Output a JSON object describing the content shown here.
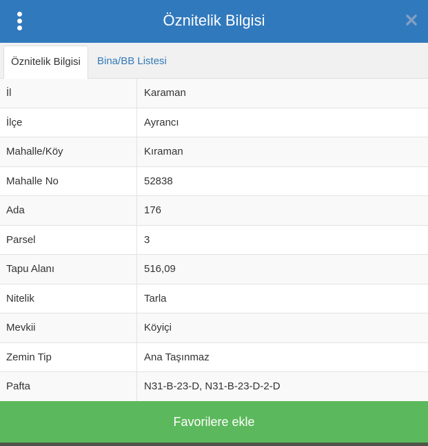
{
  "header": {
    "title": "Öznitelik Bilgisi"
  },
  "tabs": [
    {
      "label": "Öznitelik Bilgisi",
      "active": true
    },
    {
      "label": "Bina/BB Listesi",
      "active": false
    }
  ],
  "attributes": [
    {
      "key": "İl",
      "value": "Karaman"
    },
    {
      "key": "İlçe",
      "value": "Ayrancı"
    },
    {
      "key": "Mahalle/Köy",
      "value": "Kıraman"
    },
    {
      "key": "Mahalle No",
      "value": "52838"
    },
    {
      "key": "Ada",
      "value": "176"
    },
    {
      "key": "Parsel",
      "value": "3"
    },
    {
      "key": "Tapu Alanı",
      "value": "516,09"
    },
    {
      "key": "Nitelik",
      "value": "Tarla"
    },
    {
      "key": "Mevkii",
      "value": "Köyiçi"
    },
    {
      "key": "Zemin Tip",
      "value": "Ana Taşınmaz"
    },
    {
      "key": "Pafta",
      "value": "N31-B-23-D, N31-B-23-D-2-D"
    }
  ],
  "footer": {
    "favorite_label": "Favorilere ekle"
  },
  "icons": {
    "menu": "vertical-ellipsis-icon",
    "close": "close-icon"
  },
  "colors": {
    "header": "#3179bd",
    "tab_link": "#337ab7",
    "favorite_button": "#5cb85c"
  }
}
